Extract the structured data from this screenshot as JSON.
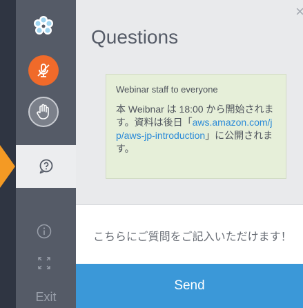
{
  "sidebar": {
    "exit_label": "Exit"
  },
  "panel": {
    "title": "Questions",
    "close_glyph": "×"
  },
  "message": {
    "from": "Webinar staff to everyone",
    "text_before": "本 Weibnar は 18:00 から開始されます。資料は後日「",
    "link_text": "aws.amazon.com/jp/aws-jp-introduction",
    "text_after": "」に公開されます。"
  },
  "compose": {
    "text": "こちらにご質問をご記入いただけます！"
  },
  "send": {
    "label": "Send"
  },
  "colors": {
    "accent_orange": "#f06a2a",
    "arrow_orange": "#f49a24",
    "send_blue": "#3b98d8",
    "link_blue": "#2a8ad8",
    "message_bg": "#e6efd9"
  },
  "icons": {
    "logo": "flower-logo-icon",
    "mic": "mic-muted-icon",
    "hand": "raise-hand-icon",
    "questions": "question-bubble-icon",
    "info": "info-icon",
    "expand": "expand-icon"
  }
}
